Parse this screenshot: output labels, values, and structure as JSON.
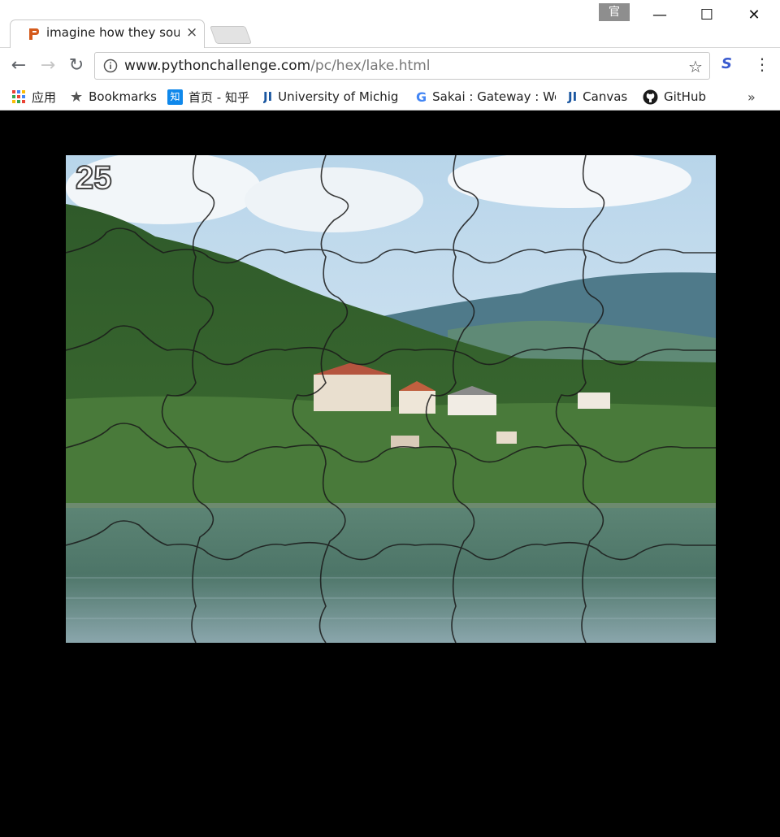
{
  "tab": {
    "title": "imagine how they sound",
    "close": "×"
  },
  "ime": "官",
  "window": {
    "minimize": "—",
    "maximize": "☐",
    "close": "✕"
  },
  "nav": {
    "back": "←",
    "forward": "→",
    "reload": "↻"
  },
  "address": {
    "host": "www.pythonchallenge.com",
    "path": "/pc/hex/lake.html"
  },
  "bookmarks": {
    "items": [
      {
        "label": "应用",
        "icon": "apps-grid-icon"
      },
      {
        "label": "Bookmarks",
        "icon": "star-icon"
      },
      {
        "label": "首页 - 知乎",
        "icon": "zhihu-icon"
      },
      {
        "label": "University of Michig",
        "icon": "ji-icon"
      },
      {
        "label": "Sakai : Gateway : We",
        "icon": "google-icon"
      },
      {
        "label": "Canvas",
        "icon": "ji-icon"
      },
      {
        "label": "GitHub",
        "icon": "github-icon"
      }
    ],
    "more": "»"
  },
  "puzzle": {
    "number": "25"
  },
  "colors": {
    "background": "#000000",
    "accent": "#3a5bcf"
  }
}
